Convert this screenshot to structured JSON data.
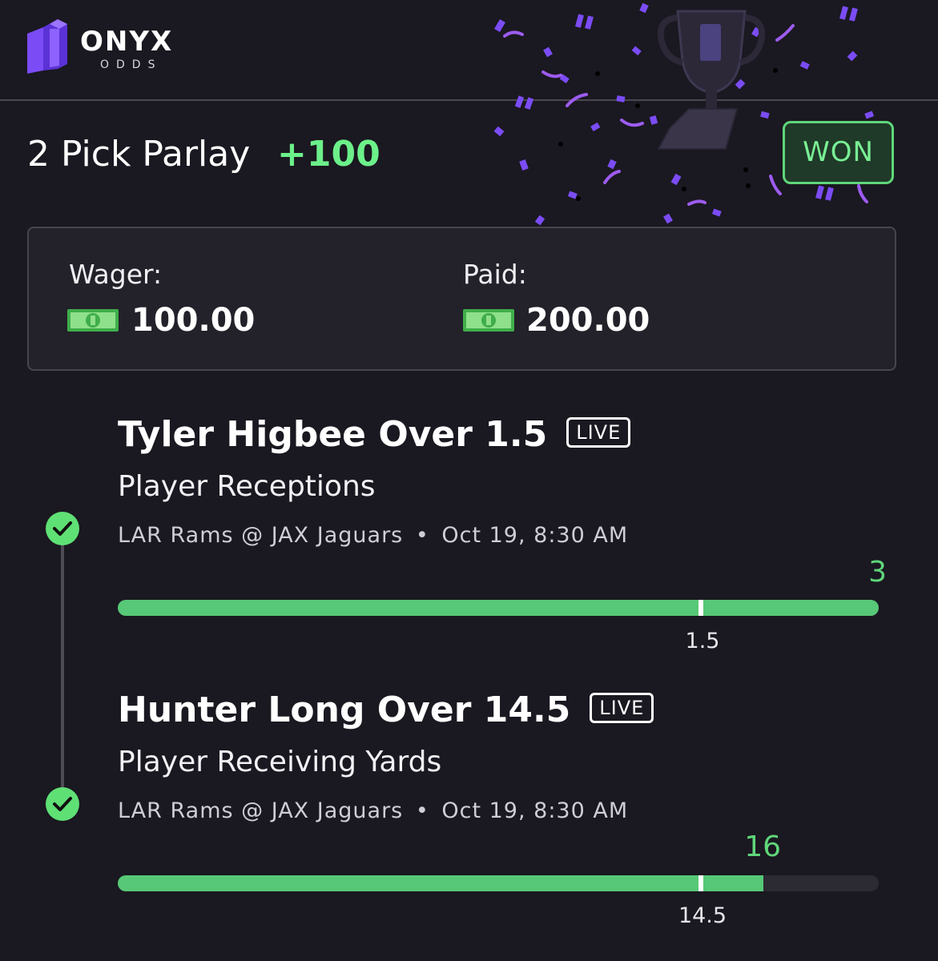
{
  "header": {
    "brand": "ONYX",
    "brand_sub": "ODDS",
    "icons": [
      "onyx-logo-icon",
      "trophy-icon",
      "confetti-icon"
    ]
  },
  "bet": {
    "title": "2 Pick Parlay",
    "odds": "+100",
    "status": "WON",
    "wager_label": "Wager:",
    "wager_value": "100.00",
    "paid_label": "Paid:",
    "paid_value": "200.00"
  },
  "picks": [
    {
      "title": "Tyler Higbee Over 1.5",
      "badge": "LIVE",
      "market": "Player Receptions",
      "game": "LAR Rams @ JAX Jaguars",
      "separator": "•",
      "time": "Oct 19, 8:30 AM",
      "result": "3",
      "line": "1.5",
      "fill_fraction": 1.0,
      "line_fraction": 0.766
    },
    {
      "title": "Hunter Long Over 14.5",
      "badge": "LIVE",
      "market": "Player Receiving Yards",
      "game": "LAR Rams @ JAX Jaguars",
      "separator": "•",
      "time": "Oct 19, 8:30 AM",
      "result": "16",
      "line": "14.5",
      "fill_fraction": 0.848,
      "line_fraction": 0.766
    }
  ],
  "colors": {
    "background": "#1a1820",
    "accent_green": "#5fd67a",
    "brand_purple": "#7b4cf5"
  }
}
